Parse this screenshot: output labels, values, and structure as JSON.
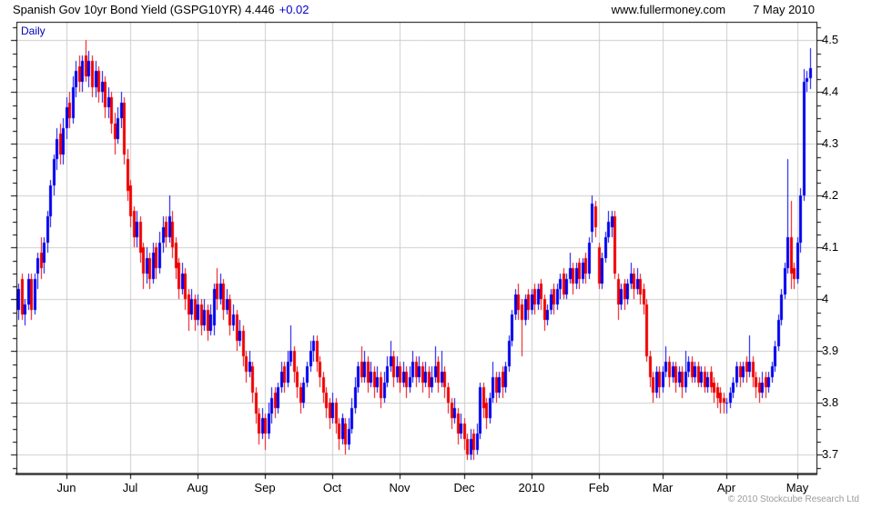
{
  "header": {
    "title": "Spanish Gov 10yr Bond Yield (GSPG10YR) 4.446",
    "change": "+0.02",
    "site": "www.fullermoney.com",
    "date": "7 May 2010"
  },
  "plot_label": "Daily",
  "footer": {
    "copyright": "© 2010 Stockcube Research Ltd"
  },
  "colors": {
    "up": "#0000ee",
    "down": "#ee0000",
    "grid": "#cccccc",
    "border": "#000000",
    "tick": "#000000",
    "accent_blue": "#0000cc",
    "copyright_gray": "#9a9a9a"
  },
  "chart_data": {
    "type": "candlestick",
    "title": "Spanish Gov 10yr Bond Yield (GSPG10YR)",
    "last_value": 4.446,
    "change_value": 0.02,
    "interval": "Daily",
    "grid": true,
    "legend_position": "none",
    "ylim": [
      3.668,
      4.537
    ],
    "y_ticks": [
      4.5,
      4.4,
      4.3,
      4.2,
      4.1,
      4.0,
      3.9,
      3.8,
      3.7
    ],
    "y_tick_labels": [
      "4.5",
      "4.4",
      "4.3",
      "4.2",
      "4.1",
      "4",
      "3.9",
      "3.8",
      "3.7"
    ],
    "y_minor_step": 0.025,
    "x_tick_labels": [
      "Jun",
      "Jul",
      "Aug",
      "Sep",
      "Oct",
      "Nov",
      "Dec",
      "2010",
      "Feb",
      "Mar",
      "Apr",
      "May"
    ],
    "x_tick_day_index": [
      15,
      35,
      56,
      77,
      98,
      119,
      139,
      160,
      181,
      201,
      221,
      243
    ],
    "candles_format": [
      "open",
      "high",
      "low",
      "close"
    ],
    "candles": [
      [
        3.98,
        4.03,
        3.96,
        4.02
      ],
      [
        4.04,
        4.05,
        3.96,
        3.97
      ],
      [
        3.97,
        4.0,
        3.95,
        3.99
      ],
      [
        3.99,
        4.05,
        3.98,
        4.04
      ],
      [
        4.04,
        4.05,
        3.96,
        3.98
      ],
      [
        3.98,
        4.05,
        3.97,
        4.04
      ],
      [
        4.05,
        4.09,
        4.02,
        4.08
      ],
      [
        4.09,
        4.12,
        4.04,
        4.06
      ],
      [
        4.07,
        4.12,
        4.05,
        4.11
      ],
      [
        4.11,
        4.17,
        4.09,
        4.16
      ],
      [
        4.16,
        4.23,
        4.14,
        4.22
      ],
      [
        4.22,
        4.28,
        4.2,
        4.27
      ],
      [
        4.27,
        4.33,
        4.25,
        4.31
      ],
      [
        4.32,
        4.34,
        4.26,
        4.28
      ],
      [
        4.28,
        4.35,
        4.26,
        4.33
      ],
      [
        4.33,
        4.39,
        4.31,
        4.37
      ],
      [
        4.38,
        4.4,
        4.33,
        4.35
      ],
      [
        4.35,
        4.43,
        4.34,
        4.41
      ],
      [
        4.41,
        4.46,
        4.39,
        4.44
      ],
      [
        4.45,
        4.47,
        4.4,
        4.42
      ],
      [
        4.42,
        4.47,
        4.4,
        4.46
      ],
      [
        4.47,
        4.5,
        4.42,
        4.43
      ],
      [
        4.43,
        4.48,
        4.41,
        4.46
      ],
      [
        4.46,
        4.47,
        4.39,
        4.41
      ],
      [
        4.41,
        4.46,
        4.39,
        4.44
      ],
      [
        4.44,
        4.45,
        4.38,
        4.4
      ],
      [
        4.4,
        4.44,
        4.38,
        4.42
      ],
      [
        4.42,
        4.43,
        4.35,
        4.37
      ],
      [
        4.37,
        4.41,
        4.35,
        4.39
      ],
      [
        4.39,
        4.4,
        4.32,
        4.34
      ],
      [
        4.34,
        4.36,
        4.28,
        4.31
      ],
      [
        4.31,
        4.37,
        4.3,
        4.35
      ],
      [
        4.35,
        4.4,
        4.33,
        4.38
      ],
      [
        4.38,
        4.39,
        4.26,
        4.28
      ],
      [
        4.27,
        4.29,
        4.19,
        4.21
      ],
      [
        4.22,
        4.23,
        4.14,
        4.16
      ],
      [
        4.17,
        4.18,
        4.1,
        4.12
      ],
      [
        4.12,
        4.17,
        4.1,
        4.15
      ],
      [
        4.15,
        4.16,
        4.07,
        4.09
      ],
      [
        4.1,
        4.11,
        4.02,
        4.05
      ],
      [
        4.05,
        4.1,
        4.03,
        4.08
      ],
      [
        4.08,
        4.09,
        4.02,
        4.04
      ],
      [
        4.04,
        4.11,
        4.03,
        4.09
      ],
      [
        4.1,
        4.11,
        4.04,
        4.06
      ],
      [
        4.06,
        4.13,
        4.05,
        4.11
      ],
      [
        4.11,
        4.16,
        4.09,
        4.14
      ],
      [
        4.15,
        4.16,
        4.1,
        4.12
      ],
      [
        4.12,
        4.2,
        4.11,
        4.16
      ],
      [
        4.15,
        4.17,
        4.08,
        4.1
      ],
      [
        4.11,
        4.12,
        4.04,
        4.06
      ],
      [
        4.07,
        4.08,
        4.0,
        4.02
      ],
      [
        4.02,
        4.07,
        4.01,
        4.05
      ],
      [
        4.05,
        4.06,
        3.98,
        4.0
      ],
      [
        4.01,
        4.02,
        3.94,
        3.97
      ],
      [
        3.97,
        4.02,
        3.96,
        4.0
      ],
      [
        4.0,
        4.01,
        3.94,
        3.96
      ],
      [
        3.96,
        4.01,
        3.95,
        3.99
      ],
      [
        3.99,
        4.0,
        3.93,
        3.95
      ],
      [
        3.95,
        4.0,
        3.94,
        3.98
      ],
      [
        3.98,
        3.99,
        3.92,
        3.94
      ],
      [
        3.94,
        3.99,
        3.93,
        3.97
      ],
      [
        3.95,
        4.03,
        3.93,
        4.02
      ],
      [
        4.03,
        4.06,
        3.98,
        4.0
      ],
      [
        4.0,
        4.05,
        3.99,
        4.03
      ],
      [
        4.03,
        4.04,
        3.96,
        3.98
      ],
      [
        3.98,
        4.02,
        3.97,
        4.0
      ],
      [
        4.0,
        4.01,
        3.93,
        3.95
      ],
      [
        3.95,
        3.99,
        3.94,
        3.97
      ],
      [
        3.97,
        3.98,
        3.9,
        3.92
      ],
      [
        3.92,
        3.96,
        3.91,
        3.94
      ],
      [
        3.94,
        3.95,
        3.87,
        3.89
      ],
      [
        3.89,
        3.9,
        3.84,
        3.86
      ],
      [
        3.86,
        3.9,
        3.85,
        3.88
      ],
      [
        3.87,
        3.88,
        3.8,
        3.82
      ],
      [
        3.82,
        3.83,
        3.76,
        3.78
      ],
      [
        3.78,
        3.79,
        3.72,
        3.74
      ],
      [
        3.74,
        3.79,
        3.73,
        3.77
      ],
      [
        3.77,
        3.78,
        3.71,
        3.74
      ],
      [
        3.74,
        3.8,
        3.73,
        3.78
      ],
      [
        3.78,
        3.83,
        3.76,
        3.81
      ],
      [
        3.82,
        3.83,
        3.77,
        3.79
      ],
      [
        3.79,
        3.84,
        3.78,
        3.83
      ],
      [
        3.83,
        3.88,
        3.82,
        3.86
      ],
      [
        3.87,
        3.88,
        3.82,
        3.84
      ],
      [
        3.84,
        3.9,
        3.83,
        3.88
      ],
      [
        3.88,
        3.95,
        3.87,
        3.9
      ],
      [
        3.9,
        3.91,
        3.84,
        3.86
      ],
      [
        3.86,
        3.87,
        3.81,
        3.83
      ],
      [
        3.83,
        3.84,
        3.78,
        3.8
      ],
      [
        3.8,
        3.85,
        3.79,
        3.84
      ],
      [
        3.84,
        3.88,
        3.83,
        3.87
      ],
      [
        3.87,
        3.92,
        3.86,
        3.9
      ],
      [
        3.9,
        3.93,
        3.88,
        3.92
      ],
      [
        3.92,
        3.93,
        3.86,
        3.88
      ],
      [
        3.88,
        3.89,
        3.83,
        3.85
      ],
      [
        3.85,
        3.86,
        3.8,
        3.82
      ],
      [
        3.82,
        3.83,
        3.77,
        3.79
      ],
      [
        3.8,
        3.81,
        3.75,
        3.77
      ],
      [
        3.77,
        3.82,
        3.76,
        3.8
      ],
      [
        3.8,
        3.81,
        3.74,
        3.76
      ],
      [
        3.76,
        3.77,
        3.71,
        3.73
      ],
      [
        3.73,
        3.78,
        3.72,
        3.77
      ],
      [
        3.76,
        3.77,
        3.7,
        3.72
      ],
      [
        3.72,
        3.77,
        3.71,
        3.75
      ],
      [
        3.75,
        3.81,
        3.74,
        3.79
      ],
      [
        3.79,
        3.85,
        3.78,
        3.83
      ],
      [
        3.83,
        3.88,
        3.82,
        3.87
      ],
      [
        3.88,
        3.91,
        3.84,
        3.85
      ],
      [
        3.85,
        3.9,
        3.84,
        3.88
      ],
      [
        3.88,
        3.89,
        3.82,
        3.84
      ],
      [
        3.84,
        3.88,
        3.83,
        3.86
      ],
      [
        3.86,
        3.87,
        3.81,
        3.83
      ],
      [
        3.83,
        3.87,
        3.82,
        3.85
      ],
      [
        3.85,
        3.86,
        3.79,
        3.81
      ],
      [
        3.81,
        3.86,
        3.8,
        3.84
      ],
      [
        3.84,
        3.89,
        3.83,
        3.87
      ],
      [
        3.87,
        3.92,
        3.86,
        3.89
      ],
      [
        3.89,
        3.9,
        3.83,
        3.85
      ],
      [
        3.85,
        3.89,
        3.84,
        3.87
      ],
      [
        3.87,
        3.88,
        3.82,
        3.84
      ],
      [
        3.84,
        3.88,
        3.83,
        3.86
      ],
      [
        3.86,
        3.87,
        3.81,
        3.83
      ],
      [
        3.83,
        3.87,
        3.82,
        3.85
      ],
      [
        3.85,
        3.9,
        3.84,
        3.88
      ],
      [
        3.88,
        3.89,
        3.83,
        3.85
      ],
      [
        3.85,
        3.89,
        3.84,
        3.87
      ],
      [
        3.87,
        3.88,
        3.82,
        3.84
      ],
      [
        3.84,
        3.88,
        3.83,
        3.86
      ],
      [
        3.86,
        3.87,
        3.81,
        3.83
      ],
      [
        3.83,
        3.87,
        3.82,
        3.85
      ],
      [
        3.85,
        3.91,
        3.84,
        3.87
      ],
      [
        3.88,
        3.89,
        3.82,
        3.84
      ],
      [
        3.84,
        3.9,
        3.83,
        3.86
      ],
      [
        3.86,
        3.87,
        3.81,
        3.83
      ],
      [
        3.83,
        3.84,
        3.78,
        3.8
      ],
      [
        3.8,
        3.81,
        3.75,
        3.77
      ],
      [
        3.77,
        3.81,
        3.76,
        3.79
      ],
      [
        3.78,
        3.79,
        3.72,
        3.74
      ],
      [
        3.74,
        3.78,
        3.73,
        3.76
      ],
      [
        3.76,
        3.77,
        3.71,
        3.73
      ],
      [
        3.73,
        3.74,
        3.69,
        3.7
      ],
      [
        3.7,
        3.75,
        3.69,
        3.73
      ],
      [
        3.74,
        3.75,
        3.69,
        3.71
      ],
      [
        3.71,
        3.76,
        3.7,
        3.74
      ],
      [
        3.74,
        3.84,
        3.73,
        3.83
      ],
      [
        3.83,
        3.84,
        3.77,
        3.79
      ],
      [
        3.8,
        3.81,
        3.75,
        3.77
      ],
      [
        3.77,
        3.82,
        3.76,
        3.81
      ],
      [
        3.81,
        3.88,
        3.8,
        3.85
      ],
      [
        3.85,
        3.86,
        3.8,
        3.82
      ],
      [
        3.82,
        3.86,
        3.81,
        3.85
      ],
      [
        3.86,
        3.87,
        3.81,
        3.83
      ],
      [
        3.83,
        3.88,
        3.82,
        3.87
      ],
      [
        3.87,
        3.93,
        3.86,
        3.92
      ],
      [
        3.92,
        3.98,
        3.91,
        3.97
      ],
      [
        3.97,
        4.02,
        3.96,
        4.01
      ],
      [
        4.01,
        4.03,
        3.96,
        3.98
      ],
      [
        3.99,
        4.0,
        3.89,
        3.96
      ],
      [
        3.96,
        4.01,
        3.95,
        4.0
      ],
      [
        4.01,
        4.02,
        3.96,
        3.98
      ],
      [
        3.98,
        4.02,
        3.97,
        4.01
      ],
      [
        4.02,
        4.03,
        3.97,
        3.99
      ],
      [
        3.99,
        4.03,
        3.98,
        4.02
      ],
      [
        4.03,
        4.04,
        3.98,
        4.0
      ],
      [
        4.0,
        4.01,
        3.94,
        3.96
      ],
      [
        3.96,
        3.99,
        3.95,
        3.98
      ],
      [
        3.98,
        4.02,
        3.97,
        4.01
      ],
      [
        4.02,
        4.03,
        3.97,
        3.99
      ],
      [
        3.99,
        4.03,
        3.98,
        4.02
      ],
      [
        4.02,
        4.05,
        4.0,
        4.04
      ],
      [
        4.05,
        4.06,
        4.0,
        4.01
      ],
      [
        4.01,
        4.05,
        4.0,
        4.04
      ],
      [
        4.04,
        4.09,
        4.03,
        4.06
      ],
      [
        4.06,
        4.07,
        4.01,
        4.03
      ],
      [
        4.03,
        4.07,
        4.02,
        4.06
      ],
      [
        4.07,
        4.08,
        4.02,
        4.04
      ],
      [
        4.04,
        4.08,
        4.03,
        4.07
      ],
      [
        4.08,
        4.09,
        4.03,
        4.05
      ],
      [
        4.05,
        4.12,
        4.04,
        4.11
      ],
      [
        4.13,
        4.2,
        4.11,
        4.185
      ],
      [
        4.18,
        4.19,
        4.12,
        4.14
      ],
      [
        4.1,
        4.11,
        4.02,
        4.03
      ],
      [
        4.03,
        4.09,
        4.02,
        4.08
      ],
      [
        4.08,
        4.13,
        4.07,
        4.12
      ],
      [
        4.12,
        4.17,
        4.11,
        4.15
      ],
      [
        4.14,
        4.17,
        4.12,
        4.16
      ],
      [
        4.16,
        4.17,
        4.04,
        4.05
      ],
      [
        4.04,
        4.05,
        3.96,
        3.99
      ],
      [
        3.99,
        4.03,
        3.98,
        4.02
      ],
      [
        4.03,
        4.04,
        3.98,
        4.0
      ],
      [
        4.0,
        4.04,
        3.99,
        4.03
      ],
      [
        4.03,
        4.07,
        4.02,
        4.05
      ],
      [
        4.05,
        4.06,
        4.0,
        4.02
      ],
      [
        4.02,
        4.06,
        4.01,
        4.04
      ],
      [
        4.04,
        4.05,
        3.99,
        4.01
      ],
      [
        4.02,
        4.03,
        3.97,
        3.99
      ],
      [
        3.99,
        4.0,
        3.88,
        3.89
      ],
      [
        3.89,
        3.9,
        3.83,
        3.85
      ],
      [
        3.85,
        3.86,
        3.8,
        3.82
      ],
      [
        3.82,
        3.87,
        3.81,
        3.86
      ],
      [
        3.86,
        3.87,
        3.81,
        3.83
      ],
      [
        3.83,
        3.87,
        3.82,
        3.86
      ],
      [
        3.86,
        3.91,
        3.85,
        3.88
      ],
      [
        3.88,
        3.89,
        3.83,
        3.85
      ],
      [
        3.85,
        3.88,
        3.84,
        3.87
      ],
      [
        3.87,
        3.88,
        3.82,
        3.84
      ],
      [
        3.84,
        3.87,
        3.83,
        3.86
      ],
      [
        3.86,
        3.87,
        3.81,
        3.83
      ],
      [
        3.83,
        3.9,
        3.82,
        3.86
      ],
      [
        3.86,
        3.89,
        3.85,
        3.88
      ],
      [
        3.88,
        3.89,
        3.84,
        3.85
      ],
      [
        3.85,
        3.88,
        3.84,
        3.87
      ],
      [
        3.87,
        3.88,
        3.83,
        3.84
      ],
      [
        3.84,
        3.87,
        3.83,
        3.86
      ],
      [
        3.86,
        3.87,
        3.82,
        3.83
      ],
      [
        3.83,
        3.86,
        3.82,
        3.85
      ],
      [
        3.86,
        3.87,
        3.82,
        3.83
      ],
      [
        3.84,
        3.85,
        3.8,
        3.82
      ],
      [
        3.83,
        3.84,
        3.79,
        3.81
      ],
      [
        3.82,
        3.83,
        3.78,
        3.8
      ],
      [
        3.81,
        3.82,
        3.78,
        3.8
      ],
      [
        3.8,
        3.81,
        3.78,
        3.8
      ],
      [
        3.8,
        3.83,
        3.79,
        3.82
      ],
      [
        3.82,
        3.85,
        3.81,
        3.84
      ],
      [
        3.84,
        3.88,
        3.83,
        3.87
      ],
      [
        3.87,
        3.88,
        3.83,
        3.85
      ],
      [
        3.85,
        3.88,
        3.84,
        3.87
      ],
      [
        3.88,
        3.89,
        3.84,
        3.86
      ],
      [
        3.86,
        3.93,
        3.85,
        3.88
      ],
      [
        3.88,
        3.89,
        3.83,
        3.85
      ],
      [
        3.85,
        3.86,
        3.81,
        3.83
      ],
      [
        3.84,
        3.85,
        3.8,
        3.82
      ],
      [
        3.82,
        3.86,
        3.81,
        3.84
      ],
      [
        3.85,
        3.86,
        3.81,
        3.83
      ],
      [
        3.83,
        3.86,
        3.82,
        3.85
      ],
      [
        3.85,
        3.88,
        3.84,
        3.87
      ],
      [
        3.87,
        3.92,
        3.86,
        3.91
      ],
      [
        3.91,
        3.97,
        3.9,
        3.96
      ],
      [
        3.96,
        4.02,
        3.95,
        4.01
      ],
      [
        4.01,
        4.07,
        4.0,
        4.06
      ],
      [
        4.06,
        4.27,
        4.05,
        4.12
      ],
      [
        4.12,
        4.19,
        4.02,
        4.05
      ],
      [
        4.06,
        4.07,
        4.02,
        4.04
      ],
      [
        4.04,
        4.12,
        4.03,
        4.11
      ],
      [
        4.11,
        4.215,
        4.09,
        4.2
      ],
      [
        4.2,
        4.445,
        4.19,
        4.42
      ],
      [
        4.42,
        4.44,
        4.4,
        4.426
      ],
      [
        4.426,
        4.485,
        4.405,
        4.446
      ]
    ]
  }
}
